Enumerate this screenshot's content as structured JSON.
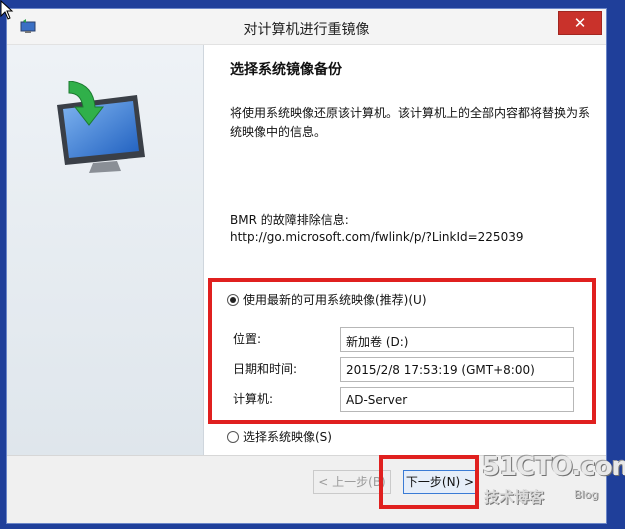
{
  "window": {
    "title": "对计算机进行重镜像",
    "close_label": "✕"
  },
  "page": {
    "heading": "选择系统镜像备份",
    "description": "将使用系统映像还原该计算机。该计算机上的全部内容都将替换为系统映像中的信息。",
    "troubleshoot_label": "BMR 的故障排除信息:",
    "troubleshoot_link": "http://go.microsoft.com/fwlink/p/?LinkId=225039"
  },
  "options": {
    "latest_label": "使用最新的可用系统映像(推荐)(U)",
    "latest_selected": true,
    "select_label": "选择系统映像(S)",
    "select_selected": false
  },
  "fields": {
    "location_label": "位置:",
    "location_value": "新加卷 (D:)",
    "datetime_label": "日期和时间:",
    "datetime_value": "2015/2/8 17:53:19 (GMT+8:00)",
    "computer_label": "计算机:",
    "computer_value": "AD-Server"
  },
  "buttons": {
    "back_label": "< 上一步(B)",
    "next_label": "下一步(N) >"
  },
  "watermark": {
    "main": "51CTO.com",
    "sub": "技术博客",
    "blog": "Blog"
  },
  "colors": {
    "desktop": "#1f3f9a",
    "highlight_box": "#e0201f",
    "close_button": "#c9322b"
  }
}
